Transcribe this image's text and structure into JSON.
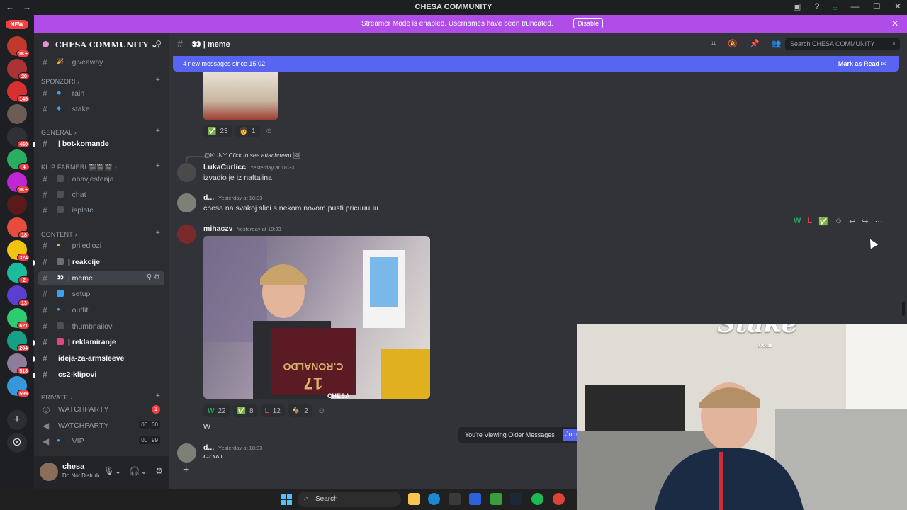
{
  "window": {
    "title": "CHESA COMMUNITY"
  },
  "guild_rail": {
    "new_label": "NEW",
    "badges": [
      "1K+",
      "20",
      "145",
      "460",
      "4",
      "1K+",
      "18",
      "324",
      "2",
      "13",
      "621",
      "204",
      "518",
      "599"
    ]
  },
  "banner": {
    "text": "Streamer Mode is enabled. Usernames have been truncated.",
    "button": "Disable"
  },
  "server": {
    "name": "CHESA COMMUNITY"
  },
  "sidebar": {
    "channels": [
      {
        "label": "| giveaway",
        "type": "text"
      },
      {
        "label": "SPONZORI",
        "type": "category"
      },
      {
        "label": "| rain",
        "type": "text"
      },
      {
        "label": "| stake",
        "type": "text"
      },
      {
        "label": "GENERAL",
        "type": "category"
      },
      {
        "label": "| bot-komande",
        "type": "text"
      },
      {
        "label": "KLIP FARMERI",
        "type": "category"
      },
      {
        "label": "| obavjestenja",
        "type": "text"
      },
      {
        "label": "| chat",
        "type": "text"
      },
      {
        "label": "| isplate",
        "type": "text"
      },
      {
        "label": "CONTENT",
        "type": "category"
      },
      {
        "label": "| prijedlozi",
        "type": "text"
      },
      {
        "label": "| reakcije",
        "type": "text"
      },
      {
        "label": "| meme",
        "type": "text"
      },
      {
        "label": "| setup",
        "type": "text"
      },
      {
        "label": "| outfit",
        "type": "text"
      },
      {
        "label": "| thumbnailovi",
        "type": "text"
      },
      {
        "label": "| reklamiranje",
        "type": "text"
      },
      {
        "label": "ideja-za-armsleeve",
        "type": "text"
      },
      {
        "label": "cs2-klipovi",
        "type": "text"
      },
      {
        "label": "PRIVATE",
        "type": "category"
      },
      {
        "label": "WATCHPARTY",
        "type": "voice",
        "badge": "1"
      },
      {
        "label": "WATCHPARTY",
        "type": "voice",
        "count_a": "00",
        "count_b": "30"
      },
      {
        "label": "| VIP",
        "type": "voice",
        "count_a": "00",
        "count_b": "99"
      }
    ]
  },
  "user": {
    "name": "chesa",
    "status": "Do Not Disturb"
  },
  "channel": {
    "name": "| meme",
    "search_placeholder": "Search CHESA COMMUNITY"
  },
  "new_messages": {
    "text": "4 new messages since 15:02",
    "action": "Mark as Read"
  },
  "messages": [
    {
      "reactions": [
        {
          "emoji": "✅",
          "count": "23"
        },
        {
          "emoji": "🧑",
          "count": "1"
        }
      ]
    },
    {
      "reply_to": "@KUNY",
      "reply_text": "Click to see attachment",
      "author": "LukaCurlicc",
      "time": "Yesterday at 18:33",
      "text": "izvadio je iz naftalina"
    },
    {
      "author": "d...",
      "time": "Yesterday at 18:33",
      "text": "chesa na svakoj slici s nekom novom pusti pricuuuuu"
    },
    {
      "author": "mihaczv",
      "time": "Yesterday at 18:33",
      "image_caption": "CHESA",
      "reactions": [
        {
          "emoji": "W",
          "count": "22"
        },
        {
          "emoji": "✅",
          "count": "8"
        },
        {
          "emoji": "L",
          "count": "12"
        },
        {
          "emoji": "🐐",
          "count": "2"
        }
      ],
      "text_after": "W"
    },
    {
      "author": "d...",
      "time": "Yesterday at 18:33",
      "text": "GOAT"
    }
  ],
  "older_messages": {
    "text": "You're Viewing Older Messages",
    "button": "Jum"
  },
  "webcam": {
    "logo": "Stake",
    "logo_sub": ".com"
  },
  "taskbar": {
    "search": "Search"
  },
  "colors": {
    "accent": "#5865f2",
    "banner": "#b04de9",
    "danger": "#f23f43"
  }
}
